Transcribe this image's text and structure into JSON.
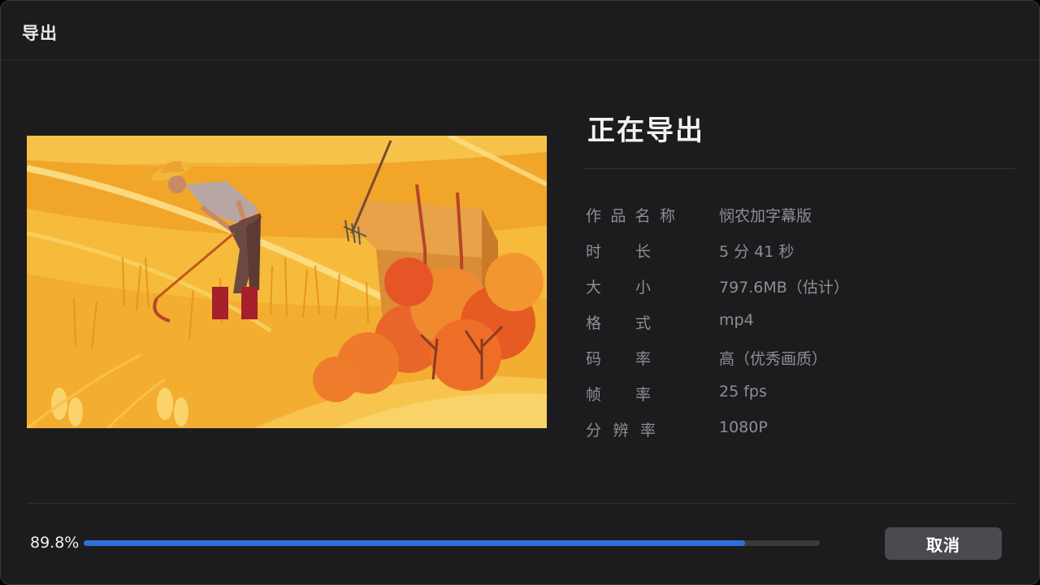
{
  "window": {
    "title": "导出"
  },
  "status": {
    "heading": "正在导出"
  },
  "details": [
    {
      "label": [
        "作",
        "品",
        "名",
        "称"
      ],
      "value": "悯农加字幕版"
    },
    {
      "label": [
        "时",
        "长"
      ],
      "value": "5 分 41 秒"
    },
    {
      "label": [
        "大",
        "小"
      ],
      "value": "797.6MB（估计）"
    },
    {
      "label": [
        "格",
        "式"
      ],
      "value": "mp4"
    },
    {
      "label": [
        "码",
        "率"
      ],
      "value": "高（优秀画质）"
    },
    {
      "label": [
        "帧",
        "率"
      ],
      "value": "25 fps"
    },
    {
      "label": [
        "分",
        "辨",
        "率"
      ],
      "value": "1080P"
    }
  ],
  "progress": {
    "value": 0.898,
    "label": "89.8%"
  },
  "buttons": {
    "cancel_label": "取消"
  },
  "preview": {
    "description_icon": "farmer-harvest-illustration"
  },
  "colors": {
    "accent": "#2f6fe0",
    "background": "#1c1c1e"
  }
}
